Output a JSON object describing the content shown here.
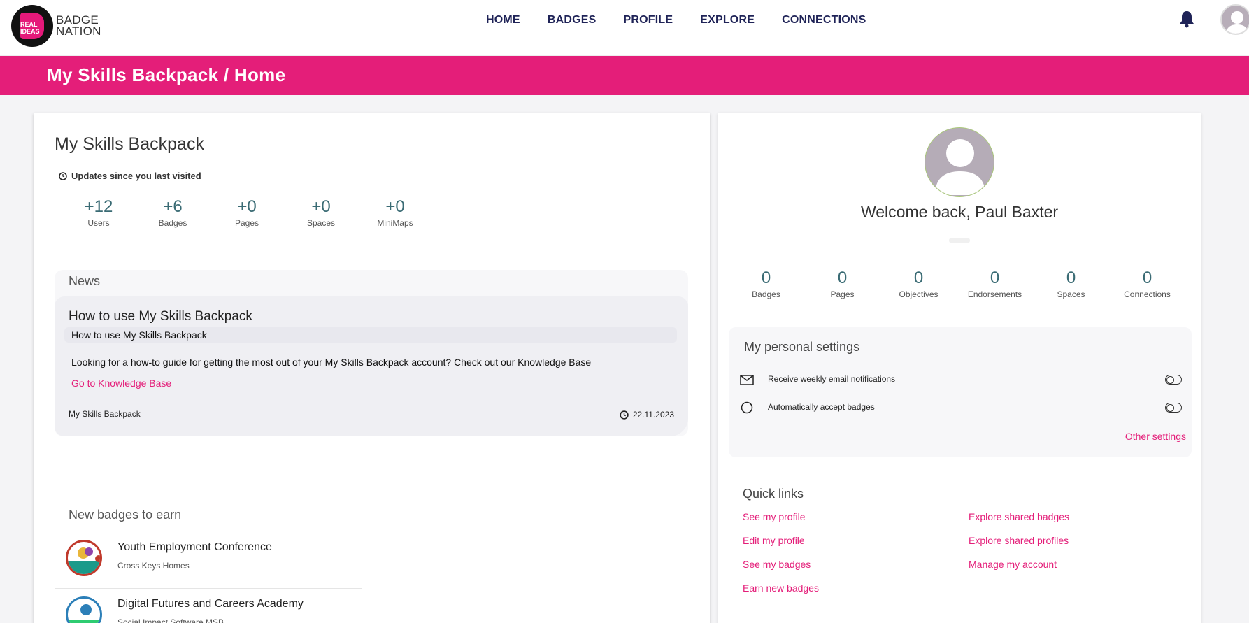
{
  "brand": {
    "line1": "BADGE",
    "line2": "NATION",
    "logo_text": "REAL IDEAS"
  },
  "nav": [
    "HOME",
    "BADGES",
    "PROFILE",
    "EXPLORE",
    "CONNECTIONS"
  ],
  "header": {
    "title": "My Skills Backpack / Home"
  },
  "left": {
    "title": "My Skills Backpack",
    "updates_label": "Updates since you last visited",
    "stats": [
      {
        "num": "+12",
        "label": "Users"
      },
      {
        "num": "+6",
        "label": "Badges"
      },
      {
        "num": "+0",
        "label": "Pages"
      },
      {
        "num": "+0",
        "label": "Spaces"
      },
      {
        "num": "+0",
        "label": "MiniMaps"
      }
    ],
    "news": {
      "heading": "News",
      "item_title": "How to use My Skills Backpack",
      "item_subtitle": "How to use My Skills Backpack",
      "item_desc": "Looking for a how-to guide for getting the most out of your My Skills Backpack account? Check out our Knowledge Base",
      "item_link": "Go to Knowledge Base",
      "item_source": "My Skills Backpack",
      "item_date": "22.11.2023"
    },
    "new_badges": {
      "heading": "New badges to earn",
      "items": [
        {
          "name": "Youth Employment Conference",
          "org": "Cross Keys Homes"
        },
        {
          "name": "Digital Futures and Careers Academy",
          "org": "Social Impact Software MSB"
        }
      ]
    }
  },
  "right": {
    "welcome": "Welcome back, Paul Baxter",
    "stats": [
      {
        "num": "0",
        "label": "Badges"
      },
      {
        "num": "0",
        "label": "Pages"
      },
      {
        "num": "0",
        "label": "Objectives"
      },
      {
        "num": "0",
        "label": "Endorsements"
      },
      {
        "num": "0",
        "label": "Spaces"
      },
      {
        "num": "0",
        "label": "Connections"
      }
    ],
    "settings": {
      "heading": "My personal settings",
      "email_notifications": "Receive weekly email notifications",
      "auto_accept": "Automatically accept badges",
      "other": "Other settings"
    },
    "quick_links": {
      "heading": "Quick links",
      "left": [
        "See my profile",
        "Edit my profile",
        "See my badges",
        "Earn new badges"
      ],
      "right": [
        "Explore shared badges",
        "Explore shared profiles",
        "Manage my account"
      ]
    }
  },
  "colors": {
    "accent": "#e41e79",
    "nav_text": "#1f2357",
    "stat_num": "#3a6b74"
  }
}
